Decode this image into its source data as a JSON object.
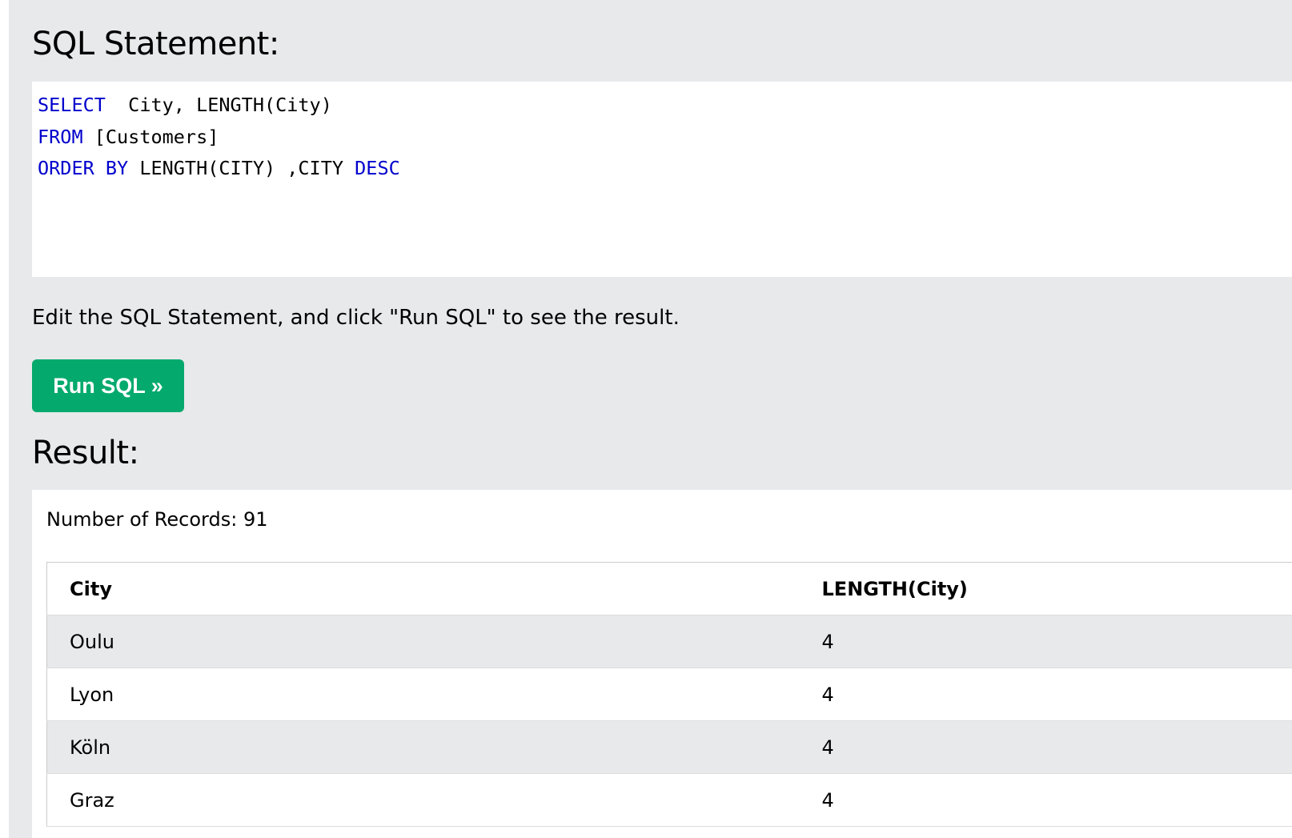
{
  "sql_section": {
    "heading": "SQL Statement:",
    "code_lines": [
      [
        {
          "text": "SELECT",
          "kw": true
        },
        {
          "text": "  City, LENGTH(City)",
          "kw": false
        }
      ],
      [
        {
          "text": "FROM",
          "kw": true
        },
        {
          "text": " [Customers]",
          "kw": false
        }
      ],
      [
        {
          "text": "ORDER BY",
          "kw": true
        },
        {
          "text": " LENGTH(CITY) ,CITY ",
          "kw": false
        },
        {
          "text": "DESC",
          "kw": true
        }
      ]
    ],
    "instructions": "Edit the SQL Statement, and click \"Run SQL\" to see the result.",
    "run_button_label": "Run SQL »"
  },
  "result_section": {
    "heading": "Result:",
    "record_count": "Number of Records: 91",
    "columns": [
      "City",
      "LENGTH(City)"
    ],
    "rows": [
      [
        "Oulu",
        "4"
      ],
      [
        "Lyon",
        "4"
      ],
      [
        "Köln",
        "4"
      ],
      [
        "Graz",
        "4"
      ]
    ]
  },
  "colors": {
    "panel_bg": "#e7e9eb",
    "keyword": "#0000cd",
    "run_button": "#04aa6d"
  }
}
